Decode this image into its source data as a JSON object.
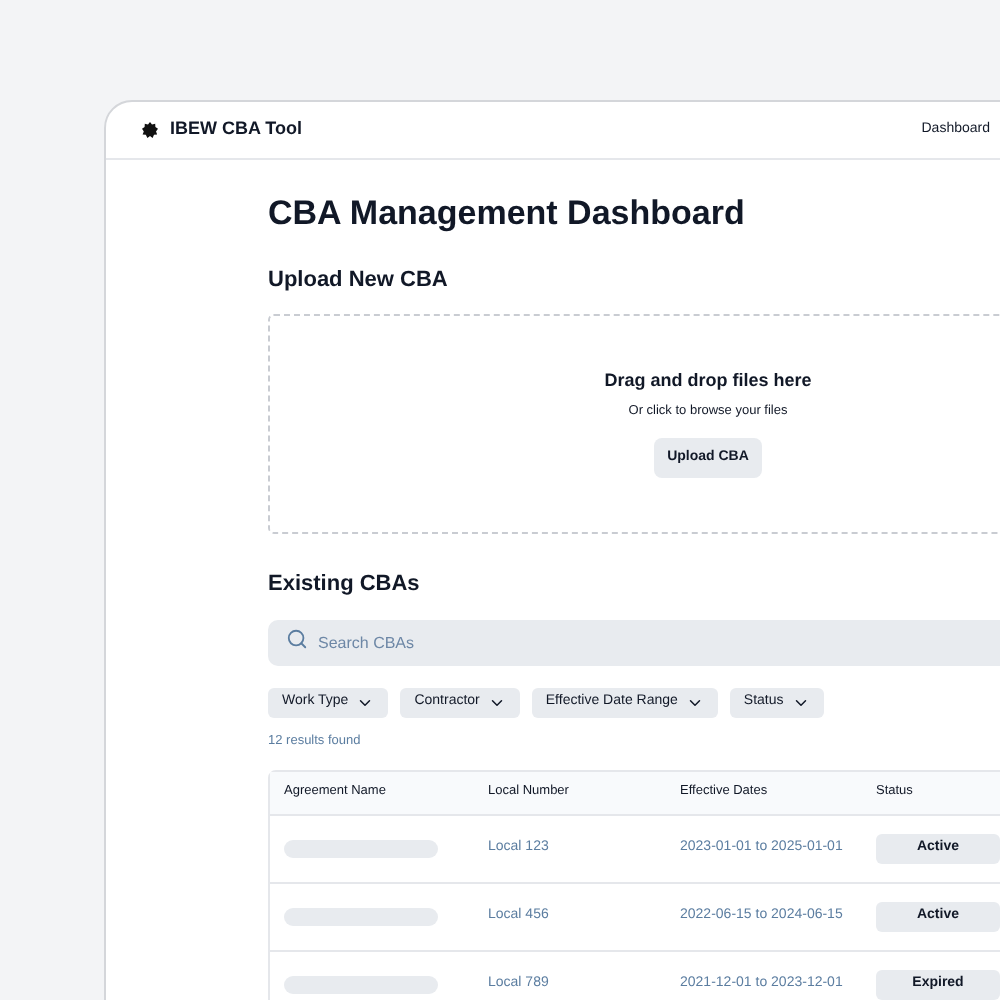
{
  "app": {
    "title": "IBEW CBA Tool",
    "nav": [
      "Dashboard"
    ]
  },
  "page_title": "CBA Management Dashboard",
  "upload": {
    "heading": "Upload New CBA",
    "title": "Drag and drop files here",
    "subtitle": "Or click to browse your files",
    "button": "Upload CBA"
  },
  "existing": {
    "heading": "Existing CBAs",
    "search": {
      "placeholder": "Search CBAs"
    },
    "filters": [
      "Work Type",
      "Contractor",
      "Effective Date Range",
      "Status"
    ],
    "results": "12 results found",
    "table": {
      "columns": [
        "Agreement Name",
        "Local Number",
        "Effective Dates",
        "Status"
      ],
      "rows": [
        {
          "local": "Local 123",
          "dates": "2023-01-01 to 2025-01-01",
          "status": "Active"
        },
        {
          "local": "Local 456",
          "dates": "2022-06-15 to 2024-06-15",
          "status": "Active"
        },
        {
          "local": "Local 789",
          "dates": "2021-12-01 to 2023-12-01",
          "status": "Expired"
        }
      ]
    }
  }
}
